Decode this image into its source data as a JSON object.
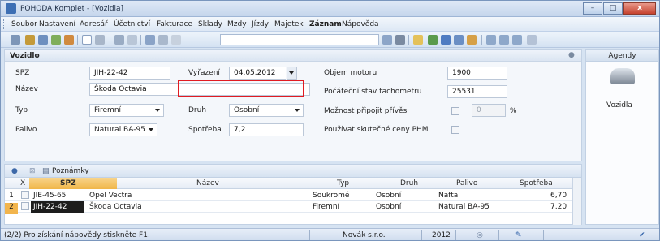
{
  "window": {
    "title": "POHODA Komplet - [Vozidla]",
    "min": "–",
    "max": "□",
    "close": "x"
  },
  "menu": [
    "Soubor",
    "Nastavení",
    "Adresář",
    "Účetnictví",
    "Fakturace",
    "Sklady",
    "Mzdy",
    "Jízdy",
    "Majetek",
    "Záznam",
    "Nápověda"
  ],
  "form": {
    "section_title": "Vozidlo",
    "spz_label": "SPZ",
    "spz_value": "JIH-22-42",
    "vyrazeni_label": "Vyřazení",
    "vyrazeni_value": "04.05.2012",
    "nazev_label": "Název",
    "nazev_value": "Škoda Octavia",
    "typ_label": "Typ",
    "typ_value": "Firemní",
    "druh_label": "Druh",
    "druh_value": "Osobní",
    "palivo_label": "Palivo",
    "palivo_value": "Natural BA-95",
    "spotreba_label": "Spotřeba",
    "spotreba_value": "7,2",
    "objem_label": "Objem motoru",
    "objem_value": "1900",
    "stav_label": "Počáteční stav tachometru",
    "stav_value": "25531",
    "privesa_label": "Možnost připojit přívěs",
    "privesa_value": "0",
    "privesa_unit": "%",
    "phm_label": "Používat skutečné ceny PHM"
  },
  "agendy": {
    "title": "Agendy",
    "item": "Vozidla"
  },
  "grid": {
    "tab_notes": "Poznámky",
    "columns": [
      "X",
      "SPZ",
      "Název",
      "Typ",
      "Druh",
      "Palivo",
      "Spotřeba"
    ],
    "rows": [
      {
        "n": "1",
        "spz": "JIE-45-65",
        "nazev": "Opel Vectra",
        "typ": "Soukromé",
        "druh": "Osobní",
        "palivo": "Nafta",
        "spotreba": "6,70"
      },
      {
        "n": "2",
        "spz": "JIH-22-42",
        "nazev": "Škoda Octavia",
        "typ": "Firemní",
        "druh": "Osobní",
        "palivo": "Natural BA-95",
        "spotreba": "7,20"
      }
    ]
  },
  "status": {
    "hint": "(2/2) Pro získání nápovědy stiskněte F1.",
    "company": "Novák s.r.o.",
    "year": "2012"
  },
  "colors": {
    "highlight": "#e11b22",
    "selected_row": "#1d1d1d",
    "accent": "#f2b54d"
  }
}
